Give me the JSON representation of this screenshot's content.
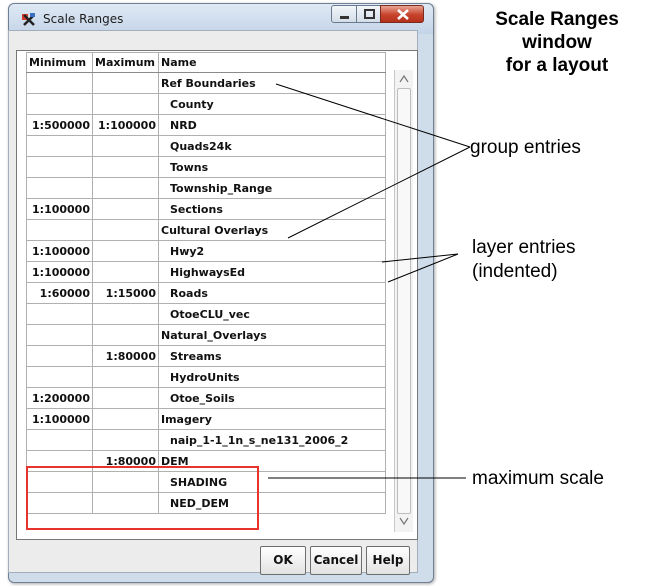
{
  "window": {
    "title": "Scale Ranges"
  },
  "table": {
    "headers": {
      "minimum": "Minimum",
      "maximum": "Maximum",
      "name": "Name"
    },
    "rows": [
      {
        "min": "",
        "max": "",
        "name": "Ref Boundaries",
        "group": true
      },
      {
        "min": "",
        "max": "",
        "name": "County",
        "group": false
      },
      {
        "min": "1:500000",
        "max": "1:100000",
        "name": "NRD",
        "group": false
      },
      {
        "min": "",
        "max": "",
        "name": "Quads24k",
        "group": false
      },
      {
        "min": "",
        "max": "",
        "name": "Towns",
        "group": false
      },
      {
        "min": "",
        "max": "",
        "name": "Township_Range",
        "group": false
      },
      {
        "min": "1:100000",
        "max": "",
        "name": "Sections",
        "group": false
      },
      {
        "min": "",
        "max": "",
        "name": "Cultural Overlays",
        "group": true
      },
      {
        "min": "1:100000",
        "max": "",
        "name": "Hwy2",
        "group": false
      },
      {
        "min": "1:100000",
        "max": "",
        "name": "HighwaysEd",
        "group": false
      },
      {
        "min": "1:60000",
        "max": "1:15000",
        "name": "Roads",
        "group": false
      },
      {
        "min": "",
        "max": "",
        "name": "OtoeCLU_vec",
        "group": false
      },
      {
        "min": "",
        "max": "",
        "name": "Natural_Overlays",
        "group": true
      },
      {
        "min": "",
        "max": "1:80000",
        "name": "Streams",
        "group": false
      },
      {
        "min": "",
        "max": "",
        "name": "HydroUnits",
        "group": false
      },
      {
        "min": "1:200000",
        "max": "",
        "name": "Otoe_Soils",
        "group": false
      },
      {
        "min": "1:100000",
        "max": "",
        "name": "Imagery",
        "group": true
      },
      {
        "min": "",
        "max": "",
        "name": "naip_1-1_1n_s_ne131_2006_2",
        "group": false
      },
      {
        "min": "",
        "max": "1:80000",
        "name": "DEM",
        "group": true
      },
      {
        "min": "",
        "max": "",
        "name": "SHADING",
        "group": false
      },
      {
        "min": "",
        "max": "",
        "name": "NED_DEM",
        "group": false
      }
    ]
  },
  "buttons": {
    "ok": "OK",
    "cancel": "Cancel",
    "help": "Help"
  },
  "annotations": {
    "heading_line1": "Scale Ranges",
    "heading_line2": "window",
    "heading_line3": "for a layout",
    "group_entries": "group entries",
    "layer_entries_line1": "layer entries",
    "layer_entries_line2": "(indented)",
    "maximum_scale": "maximum scale"
  },
  "colors": {
    "highlight": "#e8332c",
    "close_button": "#c7432c",
    "window_frame": "#cfdcea"
  },
  "icons": [
    "app-icon",
    "minimize-icon",
    "maximize-icon",
    "close-icon",
    "scroll-up-icon",
    "scroll-down-icon"
  ]
}
